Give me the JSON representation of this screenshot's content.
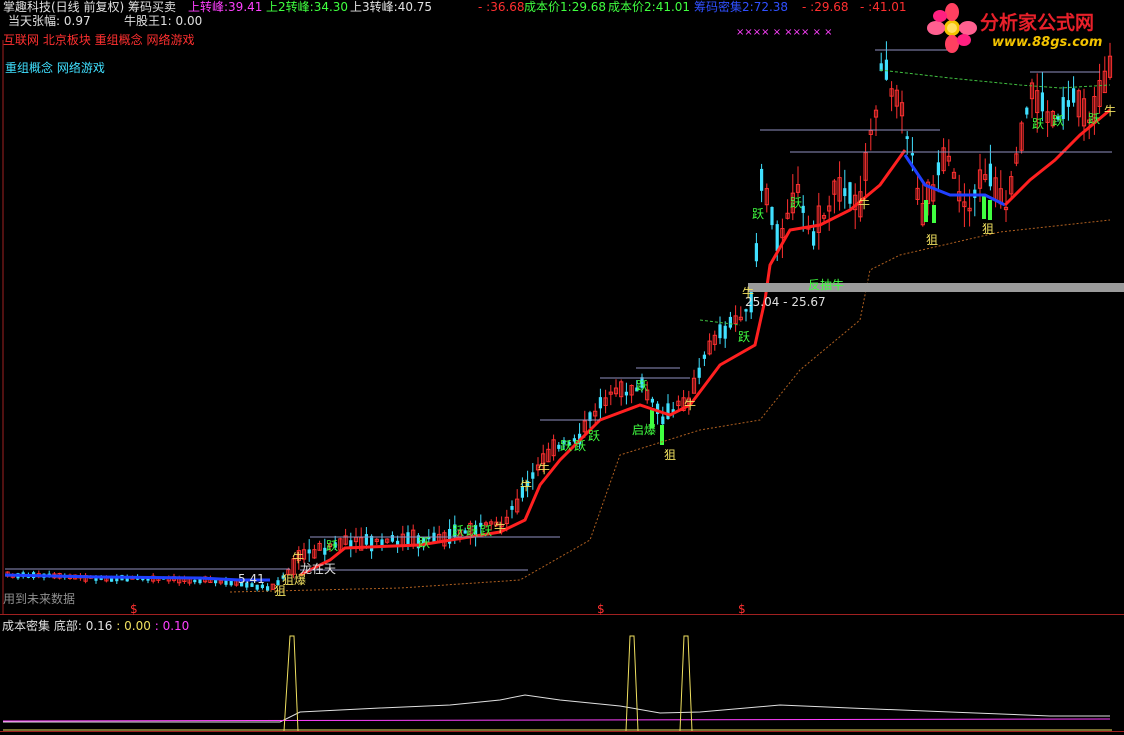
{
  "header": {
    "title": "掌趣科技(日线 前复权) 筹码买卖",
    "fields": [
      {
        "label": "上转峰:",
        "value": "39.41",
        "color": "#ff40ff"
      },
      {
        "label": "上2转峰:",
        "value": "34.30",
        "color": "#40ff40"
      },
      {
        "label": "上3转峰:",
        "value": "40.75",
        "color": "#e0e0e0"
      },
      {
        "label": "- :",
        "value": "36.68",
        "color": "#ff3030"
      },
      {
        "label": "成本价1:",
        "value": "29.68",
        "color": "#40ff40"
      },
      {
        "label": "成本价2:",
        "value": "41.01",
        "color": "#40ff40"
      },
      {
        "label": "筹码密集2:",
        "value": "72.38",
        "color": "#3050ff"
      },
      {
        "label": "- :",
        "value": "29.68",
        "color": "#ff3030"
      },
      {
        "label": "- :",
        "value": "41.01",
        "color": "#ff3030"
      }
    ],
    "row2": [
      {
        "label": "当天张幅:",
        "value": "0.97"
      },
      {
        "label": "牛股王1:",
        "value": "0.00"
      }
    ],
    "concepts_red": "互联网 北京板块 重组概念 网络游戏",
    "concepts_cyan": "重组概念 网络游戏",
    "xmarks": "×××× × ××× × ×"
  },
  "watermark": {
    "name": "分析家公式网",
    "url": "www.88gs.com"
  },
  "range_label": "25.04 - 25.67",
  "price_label": "5.41",
  "future_data_note": "用到未来数据",
  "dollar_mark": "$",
  "signals": {
    "jue": "狙",
    "yue": "跃",
    "niu": "牛",
    "qibao": "启爆",
    "fantan": "反抽牛",
    "longzaitian": "龙在天",
    "baozhuo": "狙爆"
  },
  "indicator": {
    "name": "成本密集",
    "label": "底部:",
    "v1": "0.16",
    "v2": "0.00",
    "v3": "0.10",
    "colors": {
      "v1": "#e0e0e0",
      "v2": "#f0e060",
      "v3": "#ff40ff"
    }
  },
  "colors": {
    "up": "#ff3030",
    "down": "#40e0ff",
    "accent_green": "#40ff40",
    "yellow": "#f0e060"
  }
}
